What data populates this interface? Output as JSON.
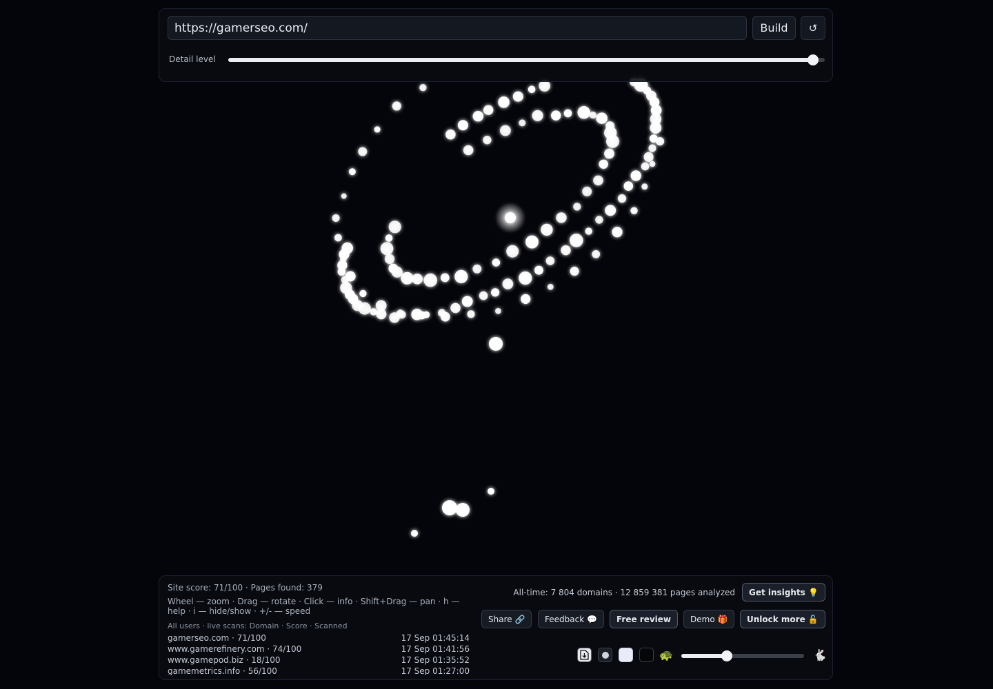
{
  "top_bar": {
    "url_value": "https://gamerseo.com/",
    "build_label": "Build",
    "refresh_icon": "↺",
    "detail_label": "Detail level",
    "detail_value": 0.98
  },
  "stats": {
    "summary": "Site score: 71/100 · Pages found: 379",
    "help": "Wheel — zoom · Drag — rotate · Click — info · Shift+Drag — pan · h — help · i — hide/show · +/- — speed",
    "feed_title": "All users · live scans: Domain · Score · Scanned",
    "feed": [
      {
        "domain": "gamerseo.com · 71/100",
        "time": "17 Sep 01:45:14"
      },
      {
        "domain": "www.gamerefinery.com · 74/100",
        "time": "17 Sep 01:41:56"
      },
      {
        "domain": "www.gamepod.biz · 18/100",
        "time": "17 Sep 01:35:52"
      },
      {
        "domain": "gamemetrics.info · 56/100",
        "time": "17 Sep 01:27:00"
      }
    ],
    "alltime": "All-time: 7 804 domains · 12 859 381 pages analyzed"
  },
  "buttons": {
    "get_insights": "Get insights 💡",
    "share": "Share 🔗",
    "feedback": "Feedback 💬",
    "free_review": "Free review",
    "demo": "Demo 🎁",
    "unlock_more": "Unlock more 🔓"
  },
  "controls": {
    "export_icon": "download-file-icon",
    "turtle_icon": "🐢",
    "rabbit_icon": "🐇",
    "speed_value": 0.37
  },
  "colors": {
    "background": "#04050a",
    "node": "#ffffff",
    "panel": "#090b11"
  }
}
